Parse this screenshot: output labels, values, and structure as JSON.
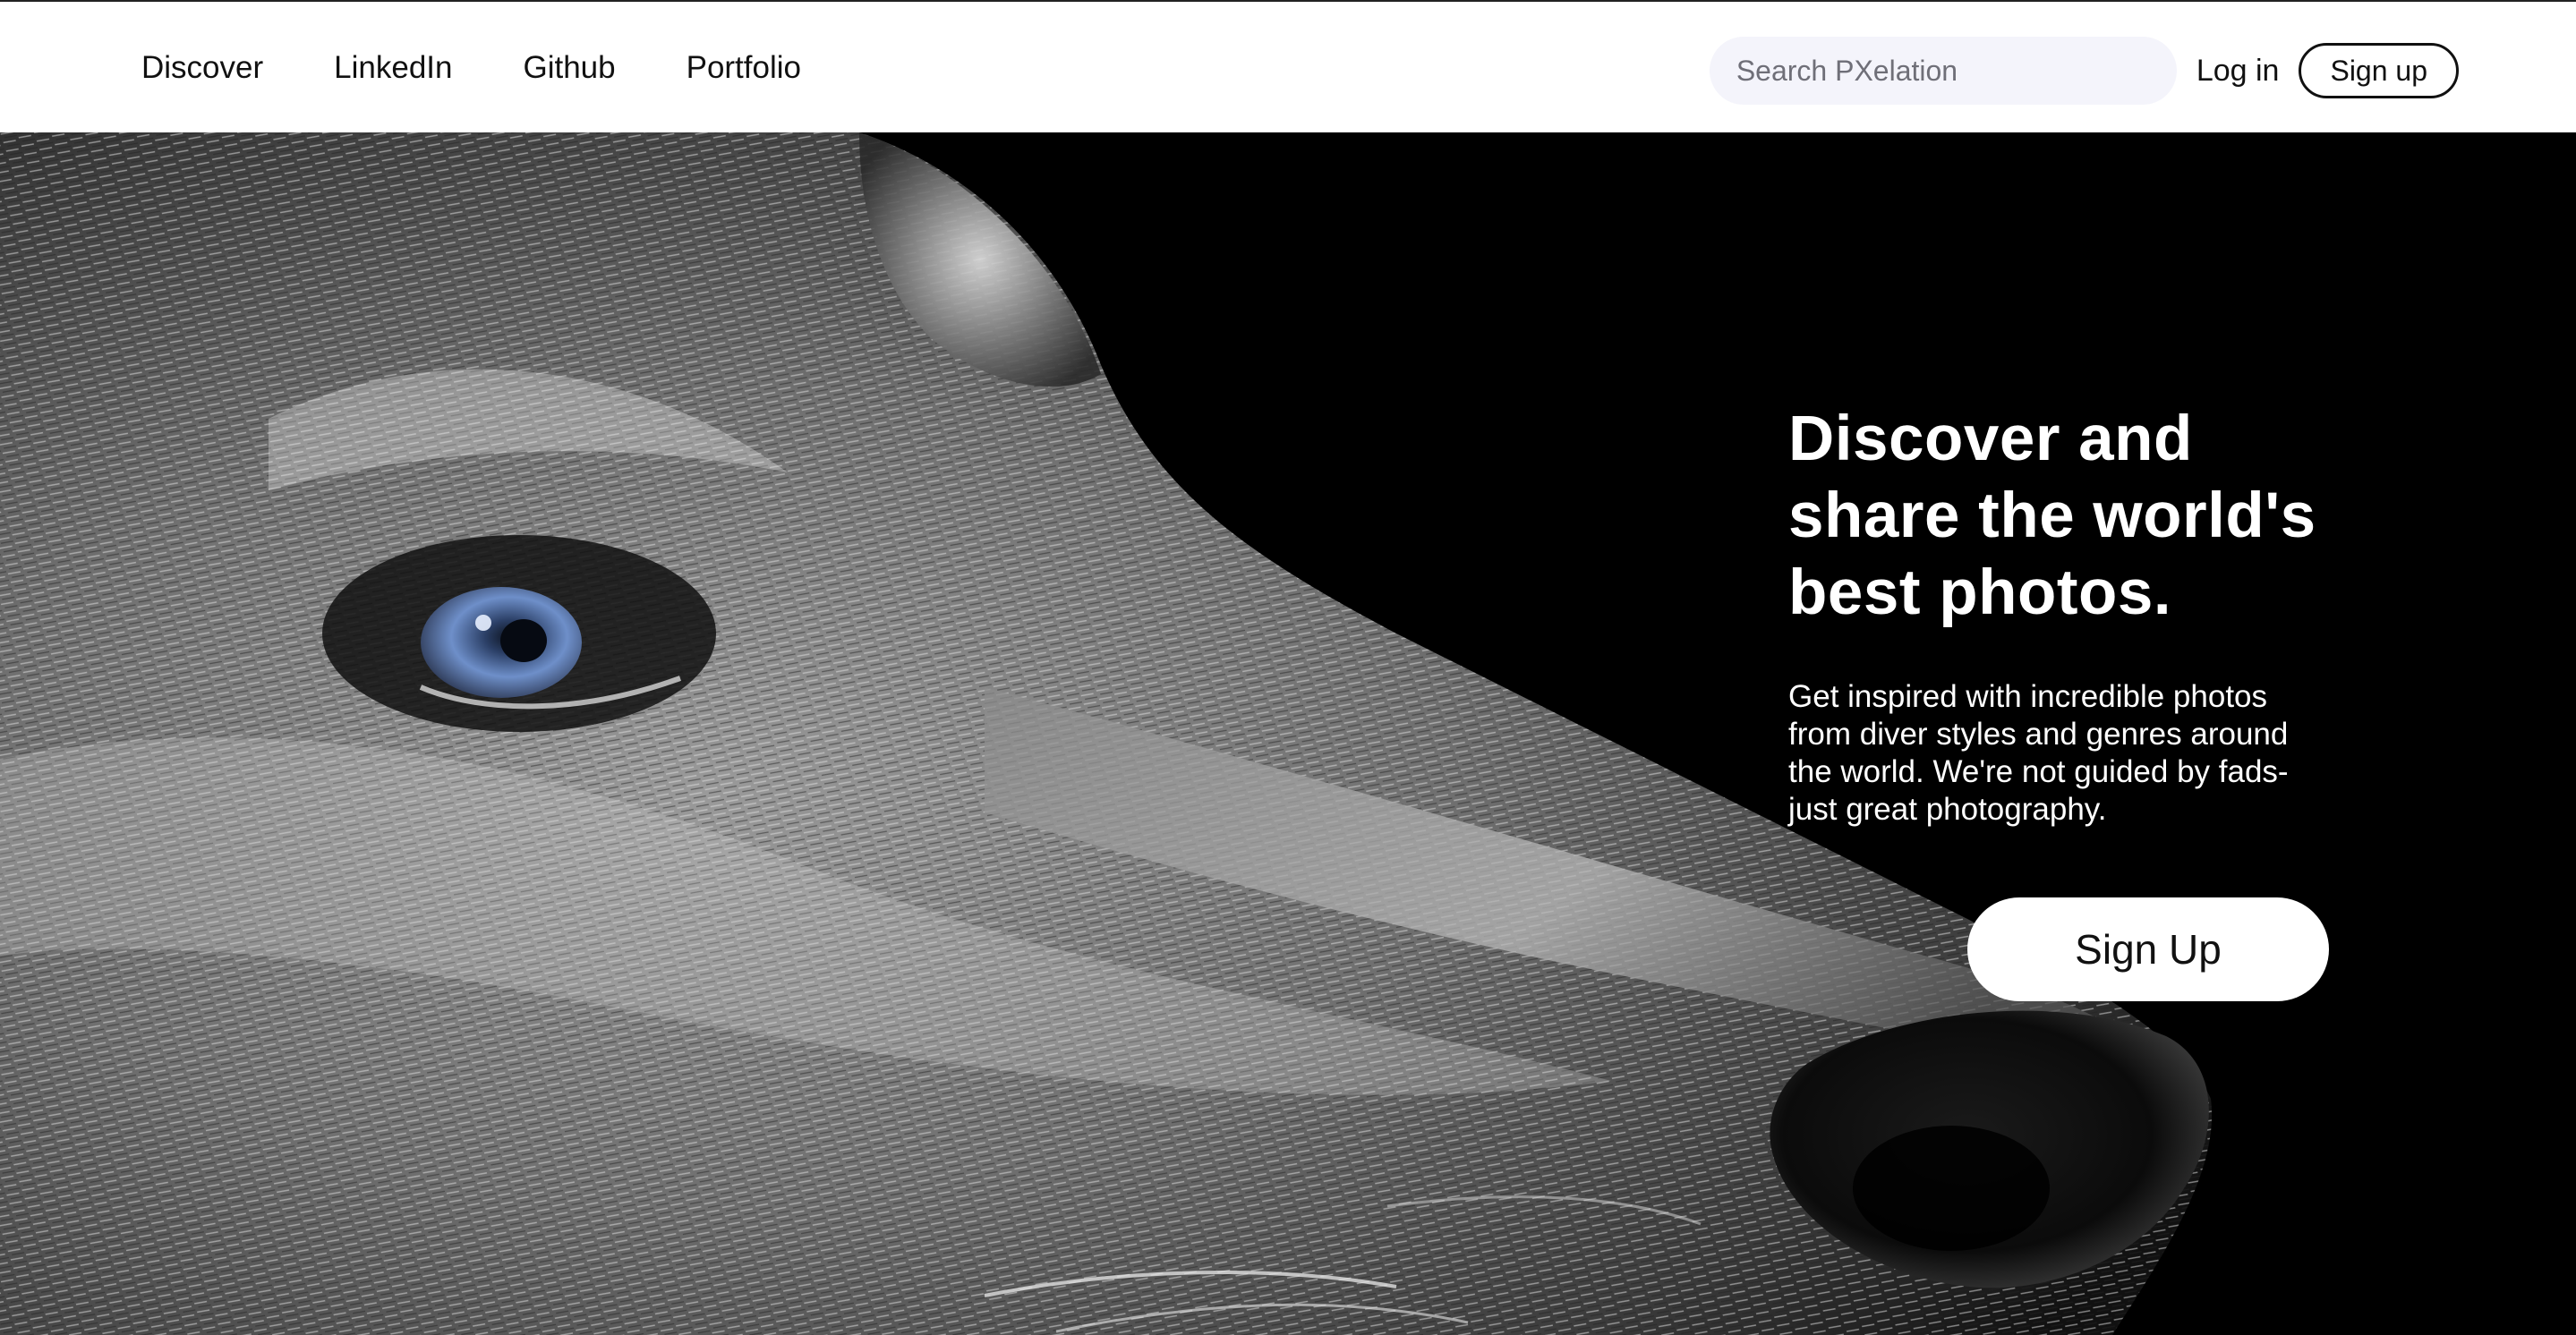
{
  "nav": {
    "links": [
      {
        "label": "Discover"
      },
      {
        "label": "LinkedIn"
      },
      {
        "label": "Github"
      },
      {
        "label": "Portfolio"
      }
    ],
    "search": {
      "placeholder": "Search PXelation",
      "value": ""
    },
    "login_label": "Log in",
    "signup_label": "Sign up"
  },
  "hero": {
    "image": "husky-dog-closeup-bw",
    "title_lines": [
      "Discover and",
      "share the world's",
      "best photos."
    ],
    "description_lines": [
      "Get inspired with incredible photos",
      "from diver styles and genres around",
      "the world. We're not guided by fads-",
      "just great photography."
    ],
    "cta_label": "Sign Up"
  },
  "colors": {
    "nav_bg": "#ffffff",
    "search_bg": "#f4f4fb",
    "hero_bg": "#000000",
    "hero_text": "#ffffff",
    "eye_blue": "#6e8fc9"
  }
}
